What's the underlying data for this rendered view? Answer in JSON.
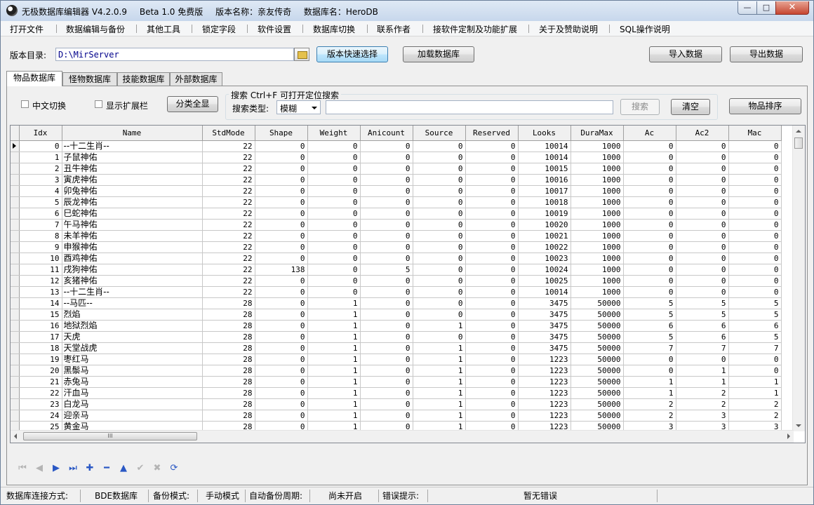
{
  "window": {
    "title_parts": [
      "无极数据库编辑器 V4.2.0.9",
      "Beta 1.0 免费版",
      "版本名称：亲友传奇",
      "数据库名：HeroDB"
    ],
    "minimize": "—",
    "maximize": "□",
    "close": "✕"
  },
  "menu": [
    "打开文件",
    "数据编辑与备份",
    "其他工具",
    "锁定字段",
    "软件设置",
    "数据库切换",
    "联系作者",
    "接软件定制及功能扩展",
    "关于及赞助说明",
    "SQL操作说明"
  ],
  "toolbar": {
    "dir_label": "版本目录:",
    "dir_value": "D:\\MirServer",
    "quick_select": "版本快速选择",
    "load_db": "加载数据库",
    "import": "导入数据",
    "export": "导出数据"
  },
  "tabs": [
    "物品数据库",
    "怪物数据库",
    "技能数据库",
    "外部数据库"
  ],
  "filters": {
    "chinese_toggle": "中文切换",
    "show_ext": "显示扩展栏",
    "show_all": "分类全显",
    "search_group": "搜索  Ctrl+F 可打开定位搜索",
    "search_type_label": "搜索类型:",
    "search_type_value": "模糊",
    "search_btn": "搜索",
    "clear_btn": "清空",
    "sort_btn": "物品排序"
  },
  "grid": {
    "columns": [
      "Idx",
      "Name",
      "StdMode",
      "Shape",
      "Weight",
      "Anicount",
      "Source",
      "Reserved",
      "Looks",
      "DuraMax",
      "Ac",
      "Ac2",
      "Mac"
    ],
    "rows": [
      [
        0,
        "--十二生肖--",
        22,
        0,
        0,
        0,
        0,
        0,
        10014,
        1000,
        0,
        0,
        0
      ],
      [
        1,
        "子鼠神佑",
        22,
        0,
        0,
        0,
        0,
        0,
        10014,
        1000,
        0,
        0,
        0
      ],
      [
        2,
        "丑牛神佑",
        22,
        0,
        0,
        0,
        0,
        0,
        10015,
        1000,
        0,
        0,
        0
      ],
      [
        3,
        "寅虎神佑",
        22,
        0,
        0,
        0,
        0,
        0,
        10016,
        1000,
        0,
        0,
        0
      ],
      [
        4,
        "卯兔神佑",
        22,
        0,
        0,
        0,
        0,
        0,
        10017,
        1000,
        0,
        0,
        0
      ],
      [
        5,
        "辰龙神佑",
        22,
        0,
        0,
        0,
        0,
        0,
        10018,
        1000,
        0,
        0,
        0
      ],
      [
        6,
        "巳蛇神佑",
        22,
        0,
        0,
        0,
        0,
        0,
        10019,
        1000,
        0,
        0,
        0
      ],
      [
        7,
        "午马神佑",
        22,
        0,
        0,
        0,
        0,
        0,
        10020,
        1000,
        0,
        0,
        0
      ],
      [
        8,
        "未羊神佑",
        22,
        0,
        0,
        0,
        0,
        0,
        10021,
        1000,
        0,
        0,
        0
      ],
      [
        9,
        "申猴神佑",
        22,
        0,
        0,
        0,
        0,
        0,
        10022,
        1000,
        0,
        0,
        0
      ],
      [
        10,
        "酉鸡神佑",
        22,
        0,
        0,
        0,
        0,
        0,
        10023,
        1000,
        0,
        0,
        0
      ],
      [
        11,
        "戌狗神佑",
        22,
        138,
        0,
        5,
        0,
        0,
        10024,
        1000,
        0,
        0,
        0
      ],
      [
        12,
        "亥猪神佑",
        22,
        0,
        0,
        0,
        0,
        0,
        10025,
        1000,
        0,
        0,
        0
      ],
      [
        13,
        "--十二生肖--",
        22,
        0,
        0,
        0,
        0,
        0,
        10014,
        1000,
        0,
        0,
        0
      ],
      [
        14,
        "--马匹--",
        28,
        0,
        1,
        0,
        0,
        0,
        3475,
        50000,
        5,
        5,
        5
      ],
      [
        15,
        "烈焰",
        28,
        0,
        1,
        0,
        0,
        0,
        3475,
        50000,
        5,
        5,
        5
      ],
      [
        16,
        "地狱烈焰",
        28,
        0,
        1,
        0,
        1,
        0,
        3475,
        50000,
        6,
        6,
        6
      ],
      [
        17,
        "天虎",
        28,
        0,
        1,
        0,
        0,
        0,
        3475,
        50000,
        5,
        6,
        5
      ],
      [
        18,
        "天堂战虎",
        28,
        0,
        1,
        0,
        1,
        0,
        3475,
        50000,
        7,
        7,
        7
      ],
      [
        19,
        "枣红马",
        28,
        0,
        1,
        0,
        1,
        0,
        1223,
        50000,
        0,
        0,
        0
      ],
      [
        20,
        "黑鬃马",
        28,
        0,
        1,
        0,
        1,
        0,
        1223,
        50000,
        0,
        1,
        0
      ],
      [
        21,
        "赤兔马",
        28,
        0,
        1,
        0,
        1,
        0,
        1223,
        50000,
        1,
        1,
        1
      ],
      [
        22,
        "汗血马",
        28,
        0,
        1,
        0,
        1,
        0,
        1223,
        50000,
        1,
        2,
        1
      ],
      [
        23,
        "白龙马",
        28,
        0,
        1,
        0,
        1,
        0,
        1223,
        50000,
        2,
        2,
        2
      ],
      [
        24,
        "迎亲马",
        28,
        0,
        1,
        0,
        1,
        0,
        1223,
        50000,
        2,
        3,
        2
      ],
      [
        25,
        "黄金马",
        28,
        0,
        1,
        0,
        1,
        0,
        1223,
        50000,
        3,
        3,
        3
      ]
    ],
    "hscroll_grip": "III"
  },
  "navigator": [
    {
      "name": "first-record-icon",
      "glyph": "⏮",
      "enabled": false
    },
    {
      "name": "prior-record-icon",
      "glyph": "◀",
      "enabled": false
    },
    {
      "name": "next-record-icon",
      "glyph": "▶",
      "enabled": true
    },
    {
      "name": "last-record-icon",
      "glyph": "⏭",
      "enabled": true
    },
    {
      "name": "insert-record-icon",
      "glyph": "✚",
      "enabled": true
    },
    {
      "name": "delete-record-icon",
      "glyph": "━",
      "enabled": true
    },
    {
      "name": "edit-record-icon",
      "glyph": "▲",
      "enabled": true
    },
    {
      "name": "post-record-icon",
      "glyph": "✔",
      "enabled": false
    },
    {
      "name": "cancel-record-icon",
      "glyph": "✖",
      "enabled": false
    },
    {
      "name": "refresh-record-icon",
      "glyph": "⟳",
      "enabled": true
    }
  ],
  "status": {
    "conn_label": "数据库连接方式:",
    "conn_value": "BDE数据库",
    "backup_label": "备份模式:",
    "backup_value": "手动模式",
    "auto_label": "自动备份周期:",
    "auto_value": "尚未开启",
    "error_label": "错误提示:",
    "error_value": "暂无错误"
  }
}
